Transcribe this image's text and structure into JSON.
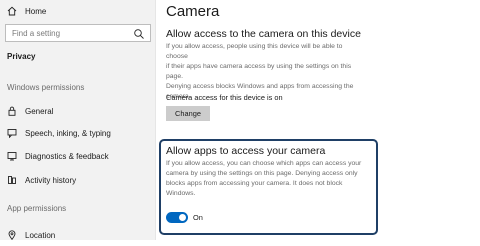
{
  "sidebar": {
    "home": {
      "label": "Home",
      "icon": "home-icon"
    },
    "search": {
      "placeholder": "Find a setting",
      "icon": "search-icon"
    },
    "category": "Privacy",
    "windows_permissions_header": "Windows permissions",
    "windows_permissions": [
      {
        "label": "General",
        "icon": "lock-icon"
      },
      {
        "label": "Speech, inking, & typing",
        "icon": "speech-icon"
      },
      {
        "label": "Diagnostics & feedback",
        "icon": "diagnostics-icon"
      },
      {
        "label": "Activity history",
        "icon": "activity-history-icon"
      }
    ],
    "app_permissions_header": "App permissions",
    "app_permissions": [
      {
        "label": "Location",
        "icon": "location-icon"
      }
    ]
  },
  "main": {
    "title": "Camera",
    "device_section": {
      "heading": "Allow access to the camera on this device",
      "description_lines": [
        "If you allow access, people using this device will be able to choose",
        "if their apps have camera access by using the settings on this page.",
        "Denying access blocks Windows and apps from accessing the",
        "camera."
      ],
      "status": "Camera access for this device is on",
      "change_button": "Change"
    },
    "apps_section": {
      "heading": "Allow apps to access your camera",
      "description_lines": [
        "If you allow access, you can choose which apps can access your",
        "camera by using the settings on this page. Denying access only",
        "blocks apps from accessing your camera. It does not block",
        "Windows."
      ],
      "toggle_state": "On",
      "toggle_on": true
    }
  },
  "colors": {
    "accent": "#0067c0",
    "sidebar_bg": "#f2f2f2",
    "focus_border": "#1f3f66"
  }
}
